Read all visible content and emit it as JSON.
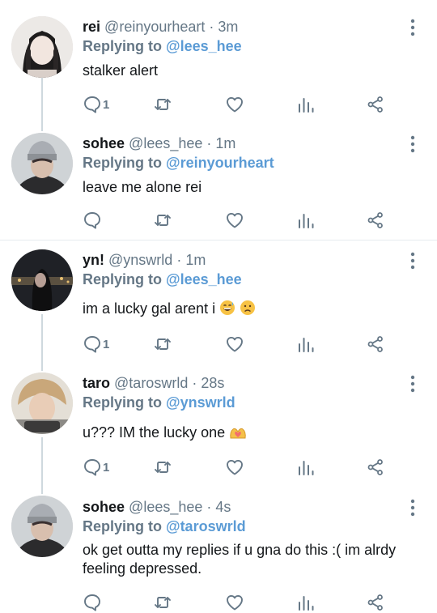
{
  "tweets": [
    {
      "name": "rei",
      "handle": "@reinyourheart",
      "time": "3m",
      "reply_prefix": "Replying to",
      "reply_to": "@lees_hee",
      "text": "stalker alert",
      "reply_count": "1"
    },
    {
      "name": "sohee",
      "handle": "@lees_hee",
      "time": "1m",
      "reply_prefix": "Replying to",
      "reply_to": "@reinyourheart",
      "text": "leave me alone rei",
      "reply_count": ""
    },
    {
      "name": "yn!",
      "handle": "@ynswrld",
      "time": "1m",
      "reply_prefix": "Replying to",
      "reply_to": "@lees_hee",
      "text": "im a lucky gal arent i",
      "reply_count": "1"
    },
    {
      "name": "taro",
      "handle": "@taroswrld",
      "time": "28s",
      "reply_prefix": "Replying to",
      "reply_to": "@ynswrld",
      "text": "u??? IM the lucky one",
      "reply_count": "1"
    },
    {
      "name": "sohee",
      "handle": "@lees_hee",
      "time": "4s",
      "reply_prefix": "Replying to",
      "reply_to": "@taroswrld",
      "text": "ok get outta my replies if u gna do this :( im alrdy feeling depressed.",
      "reply_count": ""
    }
  ],
  "separator": "·",
  "colors": {
    "link": "#5b9bd5",
    "muted": "#657786",
    "text": "#14171a",
    "line": "#cfd9de"
  },
  "icons": [
    "comment-icon",
    "retweet-icon",
    "like-icon",
    "analytics-icon",
    "share-icon",
    "more-icon"
  ]
}
